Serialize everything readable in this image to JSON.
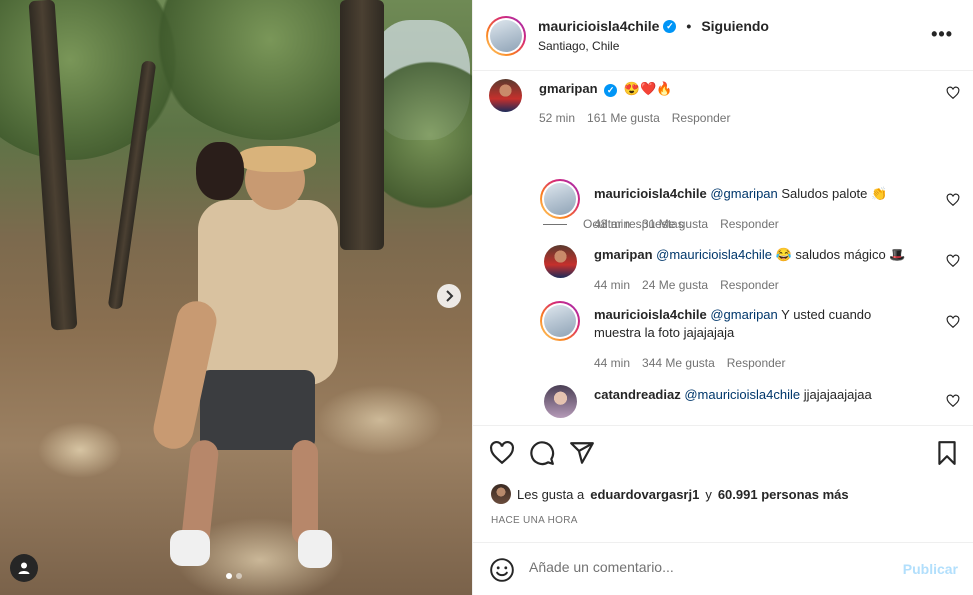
{
  "post": {
    "author": "mauricioisla4chile",
    "follow_state": "Siguiendo",
    "location": "Santiago, Chile"
  },
  "comments": [
    {
      "user": "gmaripan",
      "text": "😍❤️🔥",
      "time": "52 min",
      "likes": "161 Me gusta",
      "reply": "Responder"
    }
  ],
  "hide_replies": "Ocultar respuestas",
  "replies": [
    {
      "user": "mauricioisla4chile",
      "mention": "@gmaripan",
      "text": " Saludos palote 👏",
      "time": "48 min",
      "likes": "31 Me gusta",
      "reply": "Responder"
    },
    {
      "user": "gmaripan",
      "mention": "@mauricioisla4chile",
      "text": " 😂 saludos mágico 🎩",
      "time": "44 min",
      "likes": "24 Me gusta",
      "reply": "Responder"
    },
    {
      "user": "mauricioisla4chile",
      "mention": "@gmaripan",
      "text": " Y usted cuando muestra la foto jajajajaja",
      "time": "44 min",
      "likes": "344 Me gusta",
      "reply": "Responder"
    },
    {
      "user": "catandreadiaz",
      "mention": "@mauricioisla4chile",
      "text": " jjajajaajajaa"
    }
  ],
  "likes_line": {
    "prefix": "Les gusta a",
    "user": "eduardovargasrj1",
    "connector": "y",
    "others": "60.991 personas más"
  },
  "time_ago": "HACE UNA HORA",
  "comment_box": {
    "placeholder": "Añade un comentario...",
    "publish": "Publicar"
  },
  "icons": {
    "verified": "verified-badge-icon",
    "more": "more-options-icon",
    "like": "heart-icon",
    "comment": "comment-icon",
    "share": "share-icon",
    "save": "bookmark-icon",
    "emoji": "emoji-icon",
    "next": "chevron-right-icon",
    "tag": "user-tag-icon"
  },
  "colors": {
    "verified": "#0095f6",
    "mention": "#00376b",
    "publish_disabled": "#b2dffc",
    "meta": "#737373"
  }
}
